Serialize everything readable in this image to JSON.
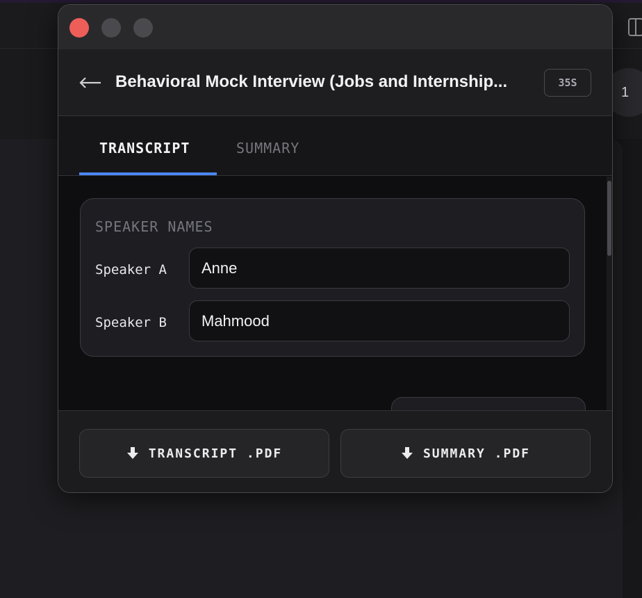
{
  "window": {
    "title": "Behavioral Mock Interview (Jobs and Internship...",
    "duration": "35S",
    "back_icon": "arrow-left-icon"
  },
  "background": {
    "badge_text": "1"
  },
  "tabs": [
    {
      "label": "TRANSCRIPT",
      "active": true
    },
    {
      "label": "SUMMARY",
      "active": false
    }
  ],
  "speakers": {
    "heading": "SPEAKER NAMES",
    "items": [
      {
        "label": "Speaker A",
        "value": "Anne"
      },
      {
        "label": "Speaker B",
        "value": "Mahmood"
      }
    ]
  },
  "footer": {
    "transcript_pdf": "TRANSCRIPT .PDF",
    "summary_pdf": "SUMMARY .PDF",
    "download_icon": "download-arrow-icon"
  },
  "colors": {
    "accent": "#4b87f2",
    "close": "#ee5e59"
  }
}
